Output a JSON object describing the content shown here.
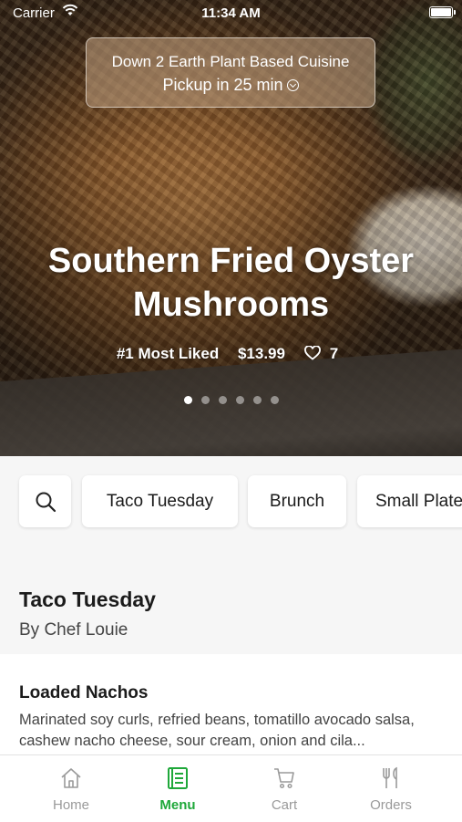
{
  "status_bar": {
    "carrier": "Carrier",
    "time": "11:34 AM"
  },
  "hero": {
    "restaurant_name": "Down 2 Earth Plant Based Cuisine",
    "pickup": "Pickup in 25 min",
    "title": "Southern Fried Oyster Mushrooms",
    "badge": "#1 Most Liked",
    "price": "$13.99",
    "likes": "7",
    "carousel": {
      "count": 6,
      "active_index": 0
    }
  },
  "categories": [
    "Taco Tuesday",
    "Brunch",
    "Small Plate"
  ],
  "section": {
    "title": "Taco Tuesday",
    "subtitle": "By Chef Louie"
  },
  "items": [
    {
      "name": "Loaded Nachos",
      "description": "Marinated soy curls, refried beans, tomatillo avocado salsa, cashew nacho cheese, sour cream, onion and cila..."
    }
  ],
  "tabs": [
    {
      "label": "Home",
      "icon": "home-icon"
    },
    {
      "label": "Menu",
      "icon": "menu-icon"
    },
    {
      "label": "Cart",
      "icon": "cart-icon"
    },
    {
      "label": "Orders",
      "icon": "fork-knife-icon"
    }
  ],
  "active_tab": "Menu",
  "colors": {
    "accent": "#1fa83a",
    "inactive": "#9a9a9a"
  }
}
